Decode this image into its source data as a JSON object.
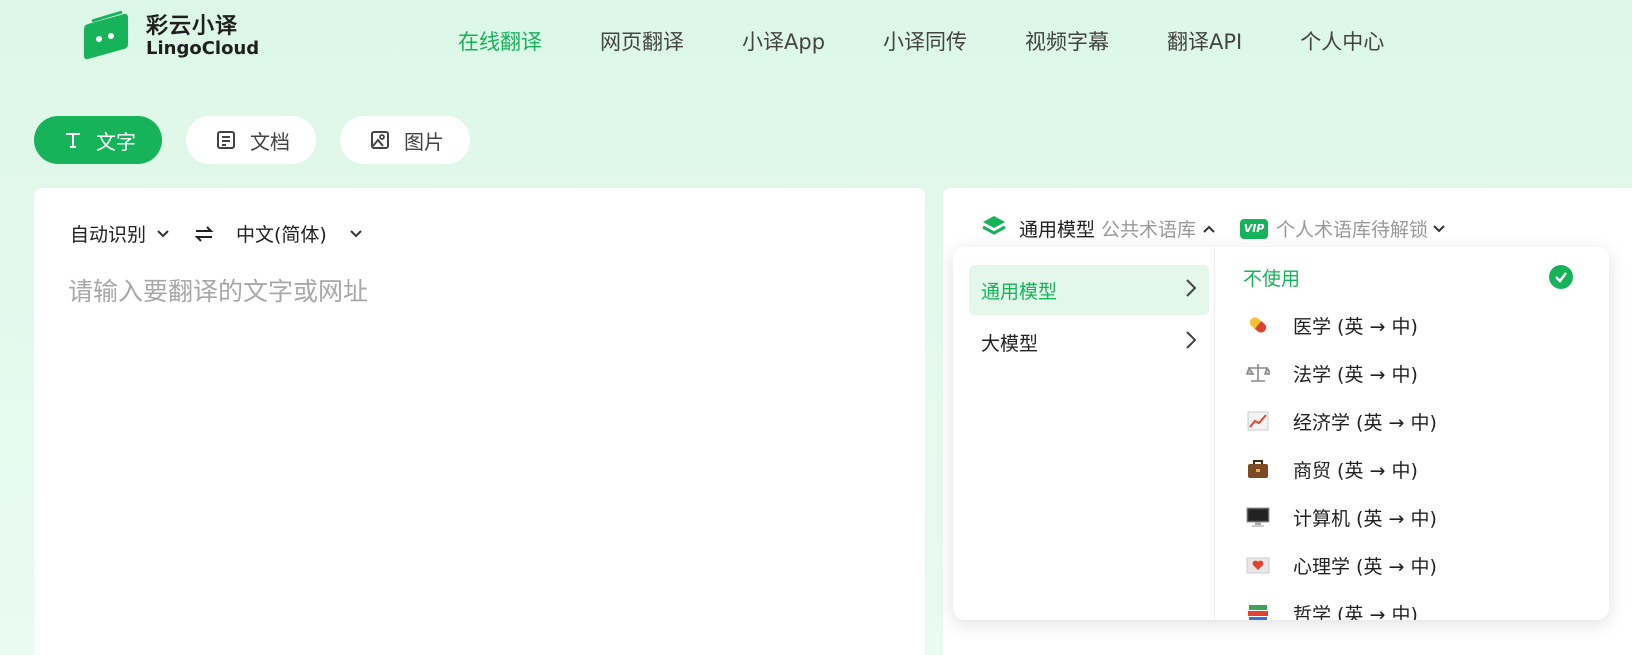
{
  "brand": {
    "name_cn": "彩云小译",
    "name_en": "LingoCloud",
    "color": "#17b35a"
  },
  "nav": [
    {
      "label": "在线翻译",
      "active": true
    },
    {
      "label": "网页翻译"
    },
    {
      "label": "小译App"
    },
    {
      "label": "小译同传"
    },
    {
      "label": "视频字幕"
    },
    {
      "label": "翻译API"
    },
    {
      "label": "个人中心"
    }
  ],
  "modes": [
    {
      "label": "文字",
      "icon": "text-icon",
      "active": true
    },
    {
      "label": "文档",
      "icon": "document-icon"
    },
    {
      "label": "图片",
      "icon": "image-icon"
    }
  ],
  "source": {
    "from_lang": "自动识别",
    "to_lang": "中文(简体)",
    "placeholder": "请输入要翻译的文字或网址"
  },
  "model_bar": {
    "model": "通用模型",
    "term_lib": "公共术语库",
    "vip_badge": "VIP",
    "personal_lib": "个人术语库待解锁"
  },
  "dropdown": {
    "categories": [
      {
        "label": "通用模型",
        "active": true
      },
      {
        "label": "大模型"
      }
    ],
    "options": [
      {
        "label": "不使用",
        "selected": true
      },
      {
        "label": "医学 (英 → 中)",
        "icon": "pill-icon"
      },
      {
        "label": "法学 (英 → 中)",
        "icon": "scales-icon"
      },
      {
        "label": "经济学 (英 → 中)",
        "icon": "chart-icon"
      },
      {
        "label": "商贸 (英 → 中)",
        "icon": "briefcase-icon"
      },
      {
        "label": "计算机 (英 → 中)",
        "icon": "computer-icon"
      },
      {
        "label": "心理学 (英 → 中)",
        "icon": "heart-letter-icon"
      },
      {
        "label": "哲学 (英 → 中)",
        "icon": "books-icon"
      }
    ]
  }
}
